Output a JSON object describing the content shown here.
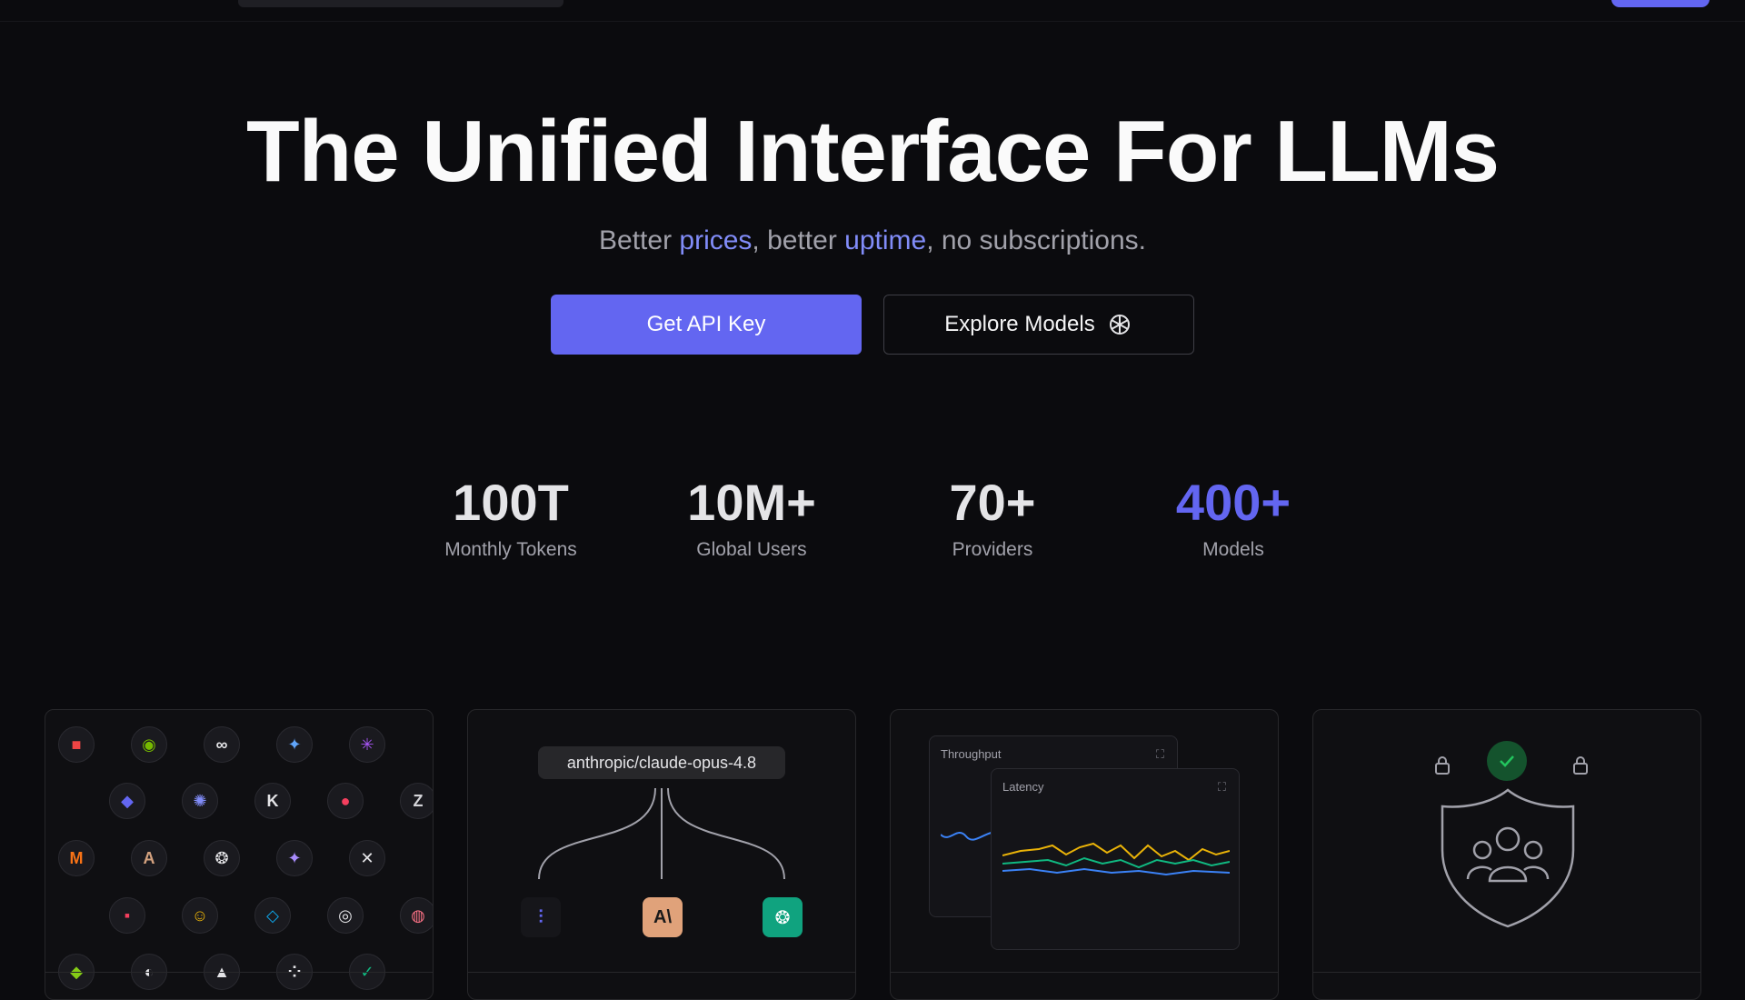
{
  "hero": {
    "title": "The Unified Interface For LLMs",
    "sub_1": "Better ",
    "sub_prices": "prices",
    "sub_2": ", better ",
    "sub_uptime": "uptime",
    "sub_3": ", no subscriptions."
  },
  "buttons": {
    "primary": "Get API Key",
    "secondary": "Explore Models"
  },
  "stats": [
    {
      "value": "100T",
      "label": "Monthly Tokens"
    },
    {
      "value": "10M+",
      "label": "Global Users"
    },
    {
      "value": "70+",
      "label": "Providers"
    },
    {
      "value": "400+",
      "label": "Models"
    }
  ],
  "cards": {
    "routing": {
      "model": "anthropic/claude-opus-4.8"
    },
    "charts": {
      "throughput_title": "Throughput",
      "latency_title": "Latency"
    }
  },
  "colors": {
    "accent": "#6366f1",
    "accent_text": "#818cf8"
  }
}
